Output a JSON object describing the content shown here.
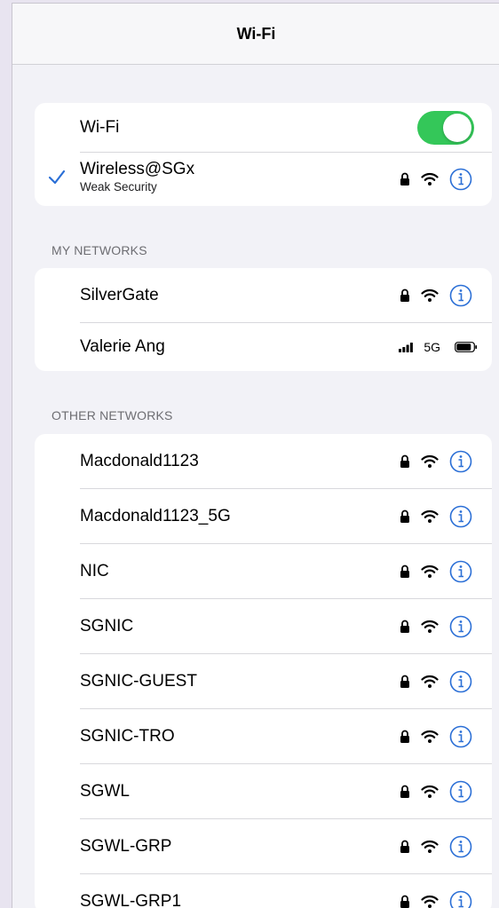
{
  "header": {
    "title": "Wi-Fi"
  },
  "wifi_toggle": {
    "label": "Wi-Fi",
    "on": true
  },
  "connected": {
    "name": "Wireless@SGx",
    "subtitle": "Weak Security"
  },
  "my_networks": {
    "header": "MY NETWORKS",
    "items": [
      {
        "name": "SilverGate"
      },
      {
        "name": "Valerie Ang",
        "hotspot_label": "5G"
      }
    ]
  },
  "other_networks": {
    "header": "OTHER NETWORKS",
    "items": [
      {
        "name": "Macdonald1123"
      },
      {
        "name": "Macdonald1123_5G"
      },
      {
        "name": "NIC"
      },
      {
        "name": "SGNIC"
      },
      {
        "name": "SGNIC-GUEST"
      },
      {
        "name": "SGNIC-TRO"
      },
      {
        "name": "SGWL"
      },
      {
        "name": "SGWL-GRP"
      },
      {
        "name": "SGWL-GRP1"
      }
    ]
  },
  "colors": {
    "accent": "#2b6fd6",
    "toggle_on": "#34c759"
  },
  "icons": [
    "checkmark-icon",
    "lock-icon",
    "wifi-icon",
    "info-icon",
    "cellular-signal-icon",
    "battery-icon"
  ]
}
